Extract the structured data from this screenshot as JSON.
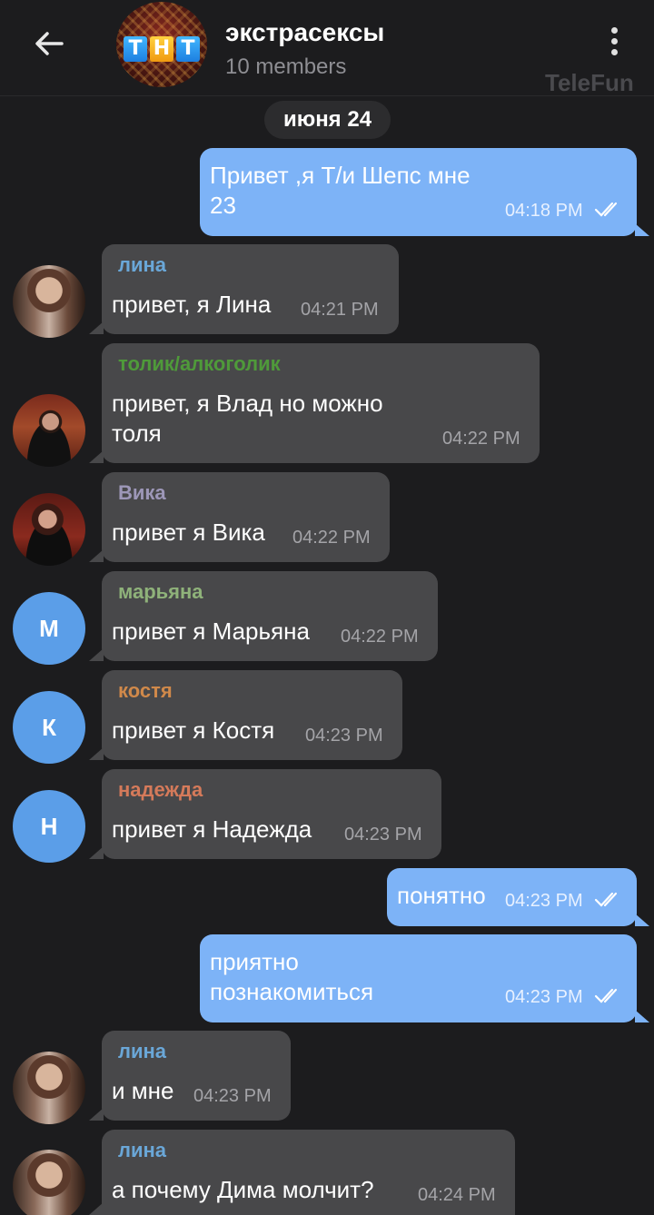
{
  "header": {
    "title": "экстрасексы",
    "subtitle": "10 members",
    "watermark": "TeleFun",
    "avatar_logo": "ТНТ"
  },
  "date_separator": "июня 24",
  "colors": {
    "background": "#1c1c1e",
    "incoming_bubble": "#48484a",
    "outgoing_bubble": "#7db3f7",
    "letter_avatar": "#5b9ee8"
  },
  "messages": [
    {
      "direction": "out",
      "text_lines": [
        "Привет ,я Т/и Шепс мне",
        "23"
      ],
      "time": "04:18 PM",
      "read": true
    },
    {
      "direction": "in",
      "sender": "лина",
      "sender_color": "#6aa7d8",
      "avatar": "photo-lina",
      "text_lines": [
        "привет, я Лина"
      ],
      "time": "04:21 PM"
    },
    {
      "direction": "in",
      "sender": "толик/алкоголик",
      "sender_color": "#4f9a3a",
      "avatar": "photo-vlad",
      "text_lines": [
        "привет, я Влад но можно",
        "толя"
      ],
      "time": "04:22 PM"
    },
    {
      "direction": "in",
      "sender": "Вика",
      "sender_color": "#9d97b8",
      "avatar": "photo-vika",
      "text_lines": [
        "привет я Вика"
      ],
      "time": "04:22 PM"
    },
    {
      "direction": "in",
      "sender": "марьяна",
      "sender_color": "#8fb27a",
      "avatar_letter": "М",
      "text_lines": [
        "привет я Марьяна"
      ],
      "time": "04:22 PM"
    },
    {
      "direction": "in",
      "sender": "костя",
      "sender_color": "#d0894a",
      "avatar_letter": "К",
      "text_lines": [
        "привет я Костя"
      ],
      "time": "04:23 PM"
    },
    {
      "direction": "in",
      "sender": "надежда",
      "sender_color": "#d57a5a",
      "avatar_letter": "Н",
      "text_lines": [
        "привет я Надежда"
      ],
      "time": "04:23 PM"
    },
    {
      "direction": "out",
      "text_lines": [
        "понятно"
      ],
      "time": "04:23 PM",
      "read": true
    },
    {
      "direction": "out",
      "text_lines": [
        "приятно",
        "познакомиться"
      ],
      "time": "04:23 PM",
      "read": true
    },
    {
      "direction": "in",
      "sender": "лина",
      "sender_color": "#6aa7d8",
      "avatar": "photo-lina",
      "text_lines": [
        "и мне"
      ],
      "time": "04:23 PM"
    },
    {
      "direction": "in",
      "sender": "лина",
      "sender_color": "#6aa7d8",
      "avatar": "photo-lina",
      "text_lines": [
        "а почему Дима молчит?"
      ],
      "time": "04:24 PM"
    }
  ]
}
